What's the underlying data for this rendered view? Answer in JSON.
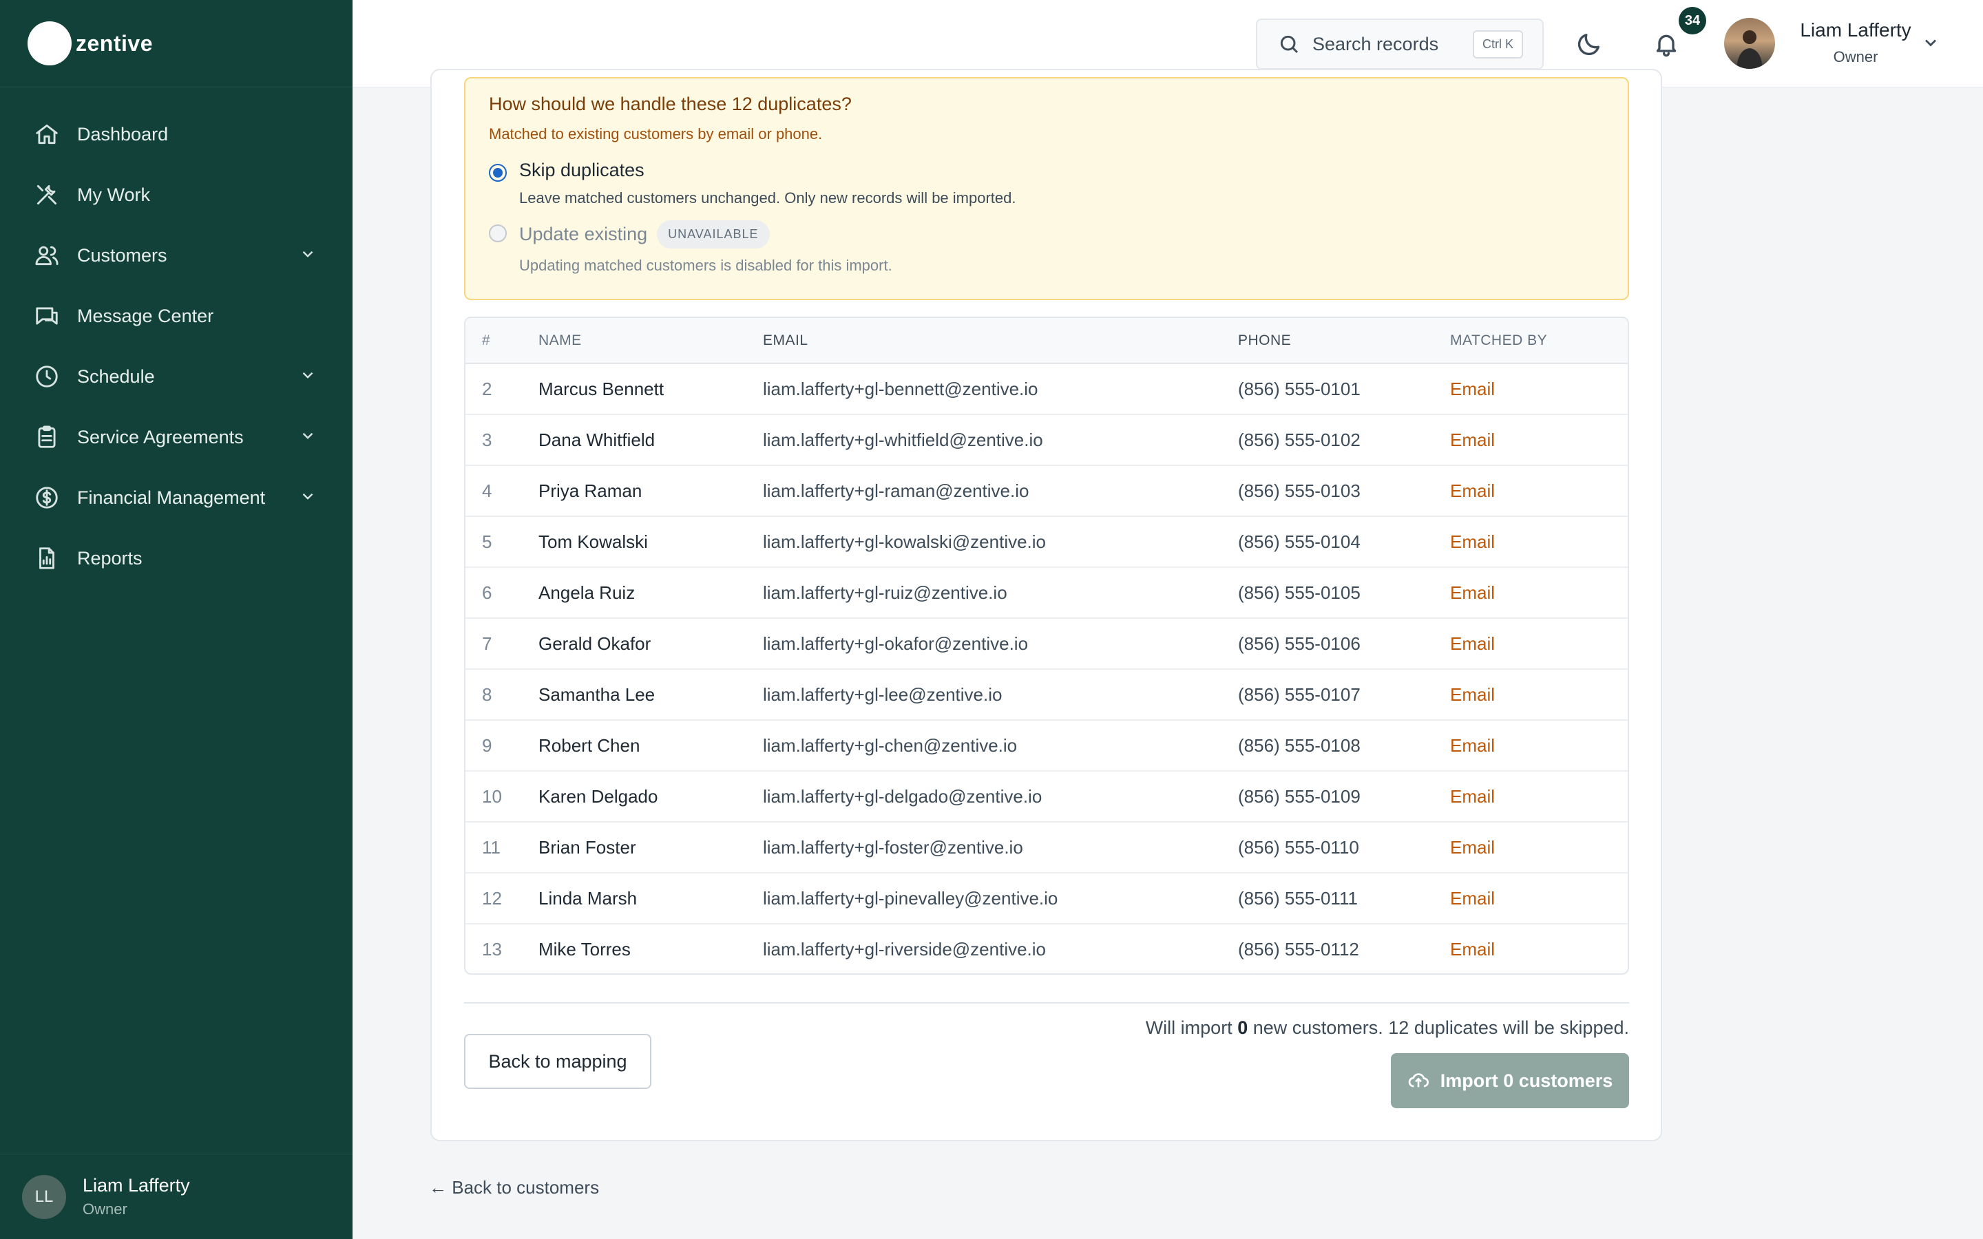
{
  "brand": {
    "name": "zentive"
  },
  "sidebar": {
    "items": [
      {
        "label": "Dashboard",
        "icon": "home-icon",
        "has_chevron": false
      },
      {
        "label": "My Work",
        "icon": "tools-icon",
        "has_chevron": false
      },
      {
        "label": "Customers",
        "icon": "users-icon",
        "has_chevron": true
      },
      {
        "label": "Message Center",
        "icon": "chat-icon",
        "has_chevron": false
      },
      {
        "label": "Schedule",
        "icon": "clock-icon",
        "has_chevron": true
      },
      {
        "label": "Service Agreements",
        "icon": "clipboard-icon",
        "has_chevron": true
      },
      {
        "label": "Financial Management",
        "icon": "dollar-icon",
        "has_chevron": true
      },
      {
        "label": "Reports",
        "icon": "report-icon",
        "has_chevron": false
      }
    ],
    "footer": {
      "initials": "LL",
      "name": "Liam Lafferty",
      "role": "Owner"
    }
  },
  "topbar": {
    "search_placeholder": "Search records",
    "search_shortcut": "Ctrl K",
    "notification_count": "34",
    "user_name": "Liam Lafferty",
    "user_role": "Owner"
  },
  "duplicates": {
    "title": "How should we handle these 12 duplicates?",
    "subtitle": "Matched to existing customers by email or phone.",
    "skip": {
      "label": "Skip duplicates",
      "description": "Leave matched customers unchanged. Only new records will be imported.",
      "selected": true
    },
    "update": {
      "label": "Update existing",
      "badge": "UNAVAILABLE",
      "description": "Updating matched customers is disabled for this import.",
      "disabled": true
    }
  },
  "table": {
    "headers": [
      "#",
      "NAME",
      "EMAIL",
      "PHONE",
      "MATCHED BY"
    ],
    "rows": [
      {
        "num": "2",
        "name": "Marcus Bennett",
        "email": "liam.lafferty+gl-bennett@zentive.io",
        "phone": "(856) 555-0101",
        "matched": "Email"
      },
      {
        "num": "3",
        "name": "Dana Whitfield",
        "email": "liam.lafferty+gl-whitfield@zentive.io",
        "phone": "(856) 555-0102",
        "matched": "Email"
      },
      {
        "num": "4",
        "name": "Priya Raman",
        "email": "liam.lafferty+gl-raman@zentive.io",
        "phone": "(856) 555-0103",
        "matched": "Email"
      },
      {
        "num": "5",
        "name": "Tom Kowalski",
        "email": "liam.lafferty+gl-kowalski@zentive.io",
        "phone": "(856) 555-0104",
        "matched": "Email"
      },
      {
        "num": "6",
        "name": "Angela Ruiz",
        "email": "liam.lafferty+gl-ruiz@zentive.io",
        "phone": "(856) 555-0105",
        "matched": "Email"
      },
      {
        "num": "7",
        "name": "Gerald Okafor",
        "email": "liam.lafferty+gl-okafor@zentive.io",
        "phone": "(856) 555-0106",
        "matched": "Email"
      },
      {
        "num": "8",
        "name": "Samantha Lee",
        "email": "liam.lafferty+gl-lee@zentive.io",
        "phone": "(856) 555-0107",
        "matched": "Email"
      },
      {
        "num": "9",
        "name": "Robert Chen",
        "email": "liam.lafferty+gl-chen@zentive.io",
        "phone": "(856) 555-0108",
        "matched": "Email"
      },
      {
        "num": "10",
        "name": "Karen Delgado",
        "email": "liam.lafferty+gl-delgado@zentive.io",
        "phone": "(856) 555-0109",
        "matched": "Email"
      },
      {
        "num": "11",
        "name": "Brian Foster",
        "email": "liam.lafferty+gl-foster@zentive.io",
        "phone": "(856) 555-0110",
        "matched": "Email"
      },
      {
        "num": "12",
        "name": "Linda Marsh",
        "email": "liam.lafferty+gl-pinevalley@zentive.io",
        "phone": "(856) 555-0111",
        "matched": "Email"
      },
      {
        "num": "13",
        "name": "Mike Torres",
        "email": "liam.lafferty+gl-riverside@zentive.io",
        "phone": "(856) 555-0112",
        "matched": "Email"
      }
    ]
  },
  "summary": {
    "prefix": "Will import ",
    "count": "0",
    "suffix": " new customers. 12 duplicates will be skipped."
  },
  "actions": {
    "back_label": "Back to mapping",
    "import_label": "Import 0 customers"
  },
  "back_link": "← Back to customers",
  "colors": {
    "sidebar_bg": "#114139",
    "accent_orange": "#c05a08",
    "radio_blue": "#1c67c7",
    "import_disabled": "#8fa6a1",
    "notice_bg": "#fef9e2"
  }
}
